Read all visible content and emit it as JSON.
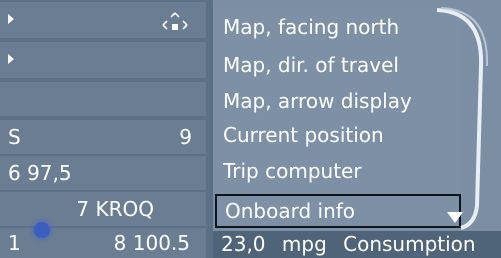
{
  "left_panel": {
    "rows": [
      {
        "clip": "",
        "num": ""
      },
      {
        "clip": "",
        "num": ""
      },
      {
        "clip": "",
        "num": ""
      },
      {
        "clip": "S",
        "num": "9"
      },
      {
        "clip": "6 97,5",
        "num": ""
      },
      {
        "clip": "",
        "num": "7 KROQ"
      },
      {
        "clip": "1",
        "num": "8 100.5"
      }
    ]
  },
  "menu": {
    "items": [
      {
        "label": "Map, facing north"
      },
      {
        "label": "Map, dir. of travel"
      },
      {
        "label": "Map, arrow display"
      },
      {
        "label": "Current position"
      },
      {
        "label": "Trip computer"
      },
      {
        "label": "Onboard info",
        "selected": true
      }
    ]
  },
  "status": {
    "value": "23,0",
    "unit": "mpg",
    "label": "Consumption"
  },
  "icons": {
    "row_arrow": "play-right-icon",
    "dpad": "direction-pad-icon",
    "scroll": "scroll-down-icon"
  },
  "colors": {
    "panel": "#7d90a6",
    "left_row": "#6a7d93",
    "status_bar": "#4f6379",
    "text": "#ffffff",
    "selection_border": "#10151b"
  }
}
